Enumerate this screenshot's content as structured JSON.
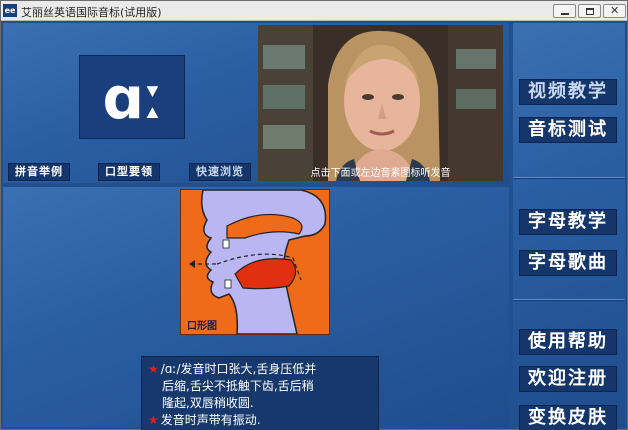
{
  "window": {
    "app_icon_text": "ee",
    "title": "艾丽丝英语国际音标(试用版)",
    "minimize_glyph": "",
    "maximize_glyph": "",
    "close_glyph": "✕"
  },
  "phonetic": {
    "symbol": "ɑː"
  },
  "video": {
    "caption": "点击下面或左边音素图标听发音"
  },
  "tabs": {
    "pinyin": "拼音举例",
    "mouth": "口型要领",
    "browse": "快速浏览"
  },
  "diagram": {
    "label": "口形图"
  },
  "description": {
    "line1": "/ɑː/发音时口张大,舌身压低并",
    "line2": "后缩,舌尖不抵触下齿,舌后稍",
    "line3": "隆起,双唇稍收圆.",
    "line4": "发音时声带有振动.",
    "star_glyph": "★"
  },
  "sidebar": {
    "video_teaching": "视频教学",
    "phonetic_test": "音标测试",
    "letter_teaching": "字母教学",
    "letter_song": "字母歌曲",
    "help": "使用帮助",
    "register": "欢迎注册",
    "change_skin": "变换皮肤"
  },
  "colors": {
    "panel_blue": "#2a5ea3",
    "dark_button": "#15366b",
    "diagram_orange": "#ef6b1a",
    "diagram_lavender": "#b9b6f2",
    "star_red": "#e02020"
  },
  "icons": [
    "app-icon",
    "minimize-icon",
    "maximize-icon",
    "close-icon",
    "star-icon"
  ]
}
